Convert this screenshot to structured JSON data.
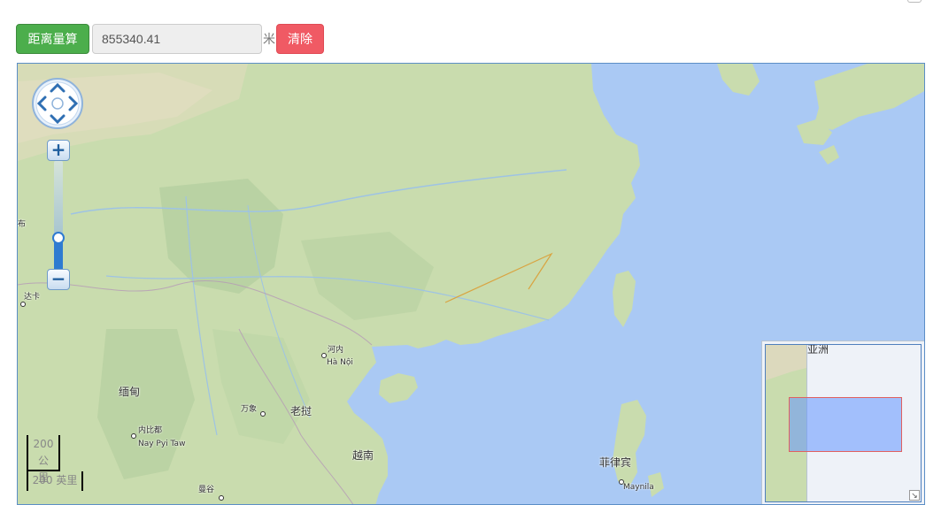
{
  "toolbar": {
    "measure_label": "距离量算",
    "distance_value": "855340.41",
    "unit_label": "米",
    "clear_label": "清除"
  },
  "map": {
    "labels": {
      "yangon_partial": "布",
      "dhaka_partial": "达卡",
      "hanoi_cn": "河内",
      "hanoi_vi": "Hà Nội",
      "myanmar": "缅甸",
      "vientiane": "万象",
      "laos": "老挝",
      "naypyitaw_cn": "内比都",
      "naypyitaw_en": "Nay Pyi Taw",
      "vietnam": "越南",
      "philippines": "菲律宾",
      "manila": "Maynila",
      "bangkok_partial": "曼谷"
    },
    "zoom_level_fraction": 0.32,
    "scale": {
      "metric_line1": "200 公",
      "metric_line2": "里",
      "imperial": "200 英里"
    },
    "overview": {
      "title": "亚洲"
    },
    "colors": {
      "ocean": "#aac9f4",
      "land": "#c9dcae",
      "measure_line": "#d9a441"
    }
  }
}
